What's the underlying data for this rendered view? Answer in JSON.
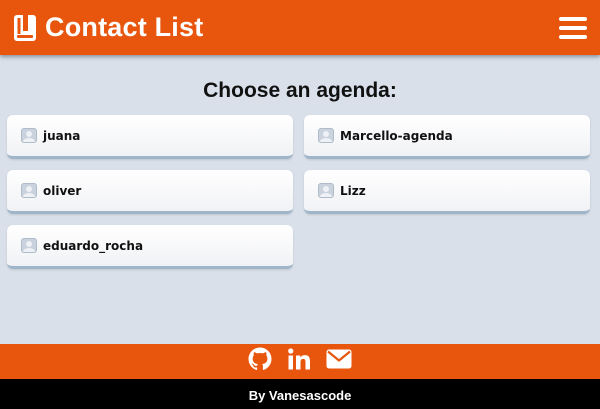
{
  "navbar": {
    "title": "Contact List",
    "logo_icon": "address-book-icon",
    "menu_icon": "hamburger-menu-icon",
    "background_color": "#e8560d"
  },
  "main": {
    "heading": "Choose an agenda:",
    "agendas": [
      {
        "name": "juana",
        "icon": "user-avatar-icon"
      },
      {
        "name": "Marcello-agenda",
        "icon": "user-avatar-icon"
      },
      {
        "name": "oliver",
        "icon": "user-avatar-icon"
      },
      {
        "name": "Lizz",
        "icon": "user-avatar-icon"
      },
      {
        "name": "eduardo_rocha",
        "icon": "user-avatar-icon"
      }
    ]
  },
  "footer": {
    "links": [
      {
        "icon": "github-icon"
      },
      {
        "icon": "linkedin-icon"
      },
      {
        "icon": "envelope-icon"
      }
    ],
    "credits": "By Vanesascode"
  }
}
